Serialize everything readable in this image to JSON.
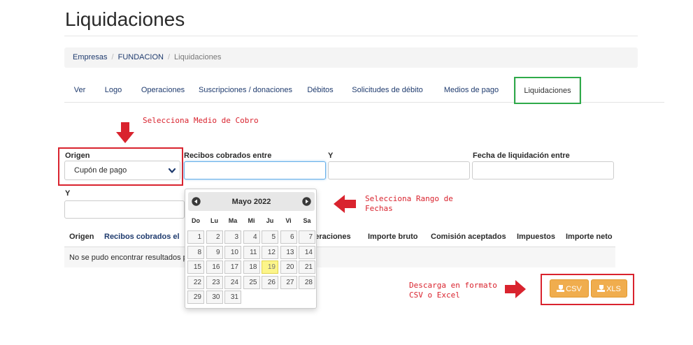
{
  "page": {
    "title": "Liquidaciones"
  },
  "breadcrumb": [
    "Empresas",
    "FUNDACION",
    "Liquidaciones"
  ],
  "tabs": [
    "Ver",
    "Logo",
    "Operaciones",
    "Suscripciones / donaciones",
    "Débitos",
    "Solicitudes de débito",
    "Medios de pago",
    "Liquidaciones"
  ],
  "active_tab": "Liquidaciones",
  "annotations": {
    "medio_cobro": "Selecciona Medio de Cobro",
    "rango_fechas_1": "Selecciona Rango de",
    "rango_fechas_2": "Fechas",
    "descarga_1": "Descarga en formato",
    "descarga_2": "CSV o Excel"
  },
  "filters": {
    "origen_label": "Origen",
    "origen_value": "Cupón de pago",
    "recibos_label": "Recibos cobrados entre",
    "recibos_y_label": "Y",
    "liquidacion_label": "Fecha de liquidación entre",
    "liquidacion_y_label": "Y"
  },
  "table": {
    "columns": [
      "Origen",
      "Recibos cobrados el",
      "Operaciones",
      "Importe bruto",
      "Comisión aceptados",
      "Impuestos",
      "Importe neto"
    ],
    "empty_message": "No se pudo encontrar resultados p"
  },
  "datepicker": {
    "month_label": "Mayo 2022",
    "weekdays": [
      "Do",
      "Lu",
      "Ma",
      "Mi",
      "Ju",
      "Vi",
      "Sa"
    ],
    "weeks": [
      [
        "1",
        "2",
        "3",
        "4",
        "5",
        "6",
        "7"
      ],
      [
        "8",
        "9",
        "10",
        "11",
        "12",
        "13",
        "14"
      ],
      [
        "15",
        "16",
        "17",
        "18",
        "19",
        "20",
        "21"
      ],
      [
        "22",
        "23",
        "24",
        "25",
        "26",
        "27",
        "28"
      ],
      [
        "29",
        "30",
        "31"
      ]
    ],
    "today": "19"
  },
  "export": {
    "csv_label": "CSV",
    "xls_label": "XLS"
  },
  "colors": {
    "annotation_red": "#d9232e",
    "highlight_green": "#2faa4a",
    "button_orange": "#f0ad4e",
    "link_blue": "#1f3b6e",
    "today_yellow": "#fcf58a"
  }
}
